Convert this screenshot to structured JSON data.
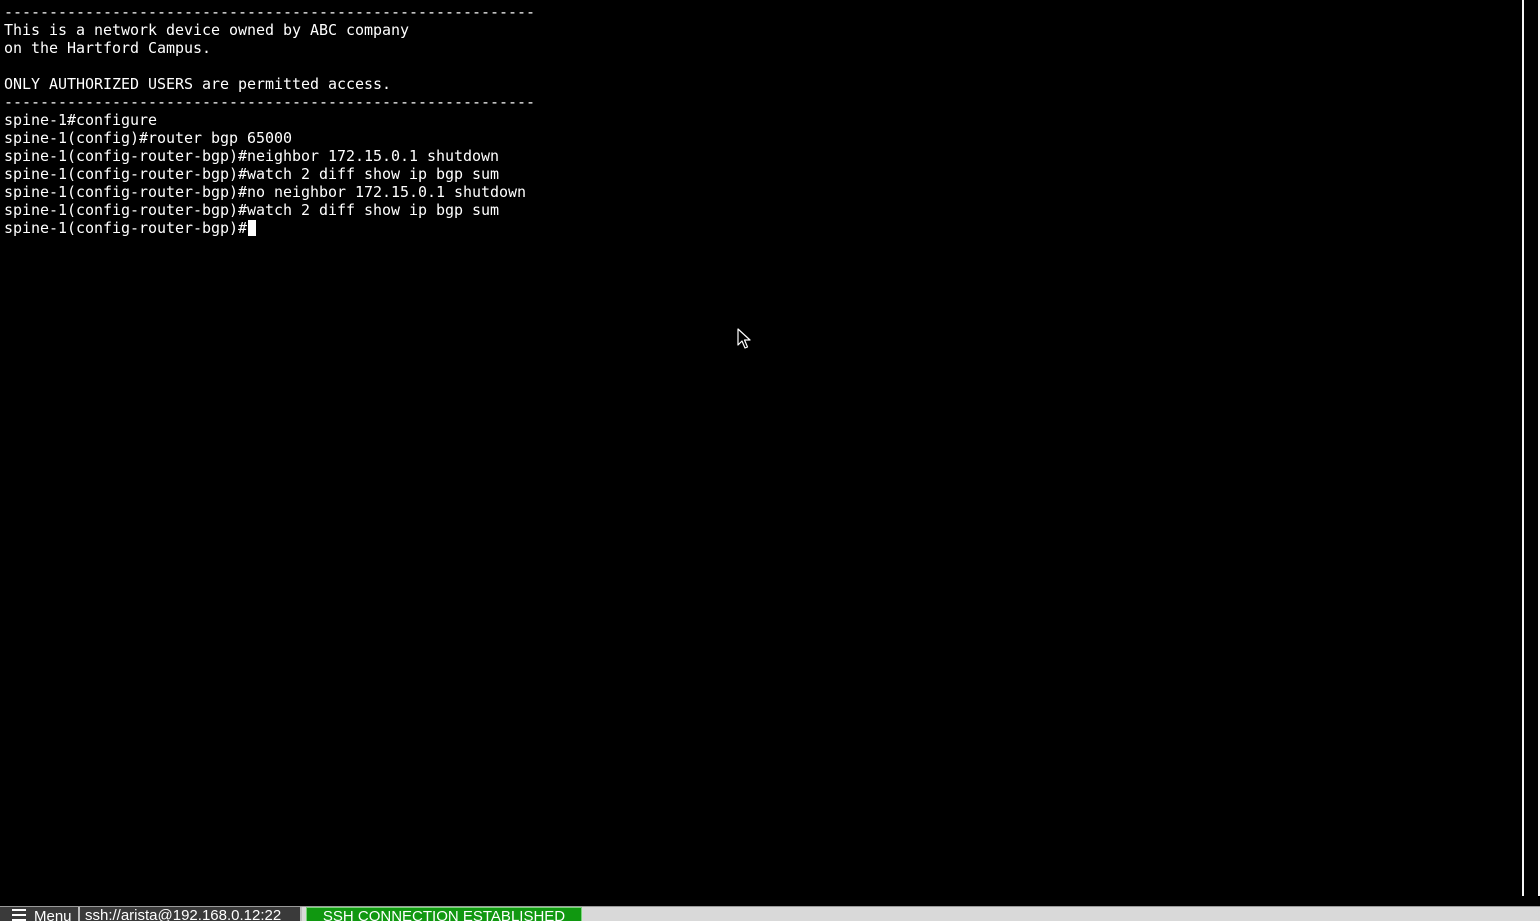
{
  "terminal": {
    "lines": [
      "-----------------------------------------------------------",
      "This is a network device owned by ABC company",
      "on the Hartford Campus.",
      "",
      "ONLY AUTHORIZED USERS are permitted access.",
      "-----------------------------------------------------------",
      "spine-1#configure",
      "spine-1(config)#router bgp 65000",
      "spine-1(config-router-bgp)#neighbor 172.15.0.1 shutdown",
      "spine-1(config-router-bgp)#watch 2 diff show ip bgp sum",
      "spine-1(config-router-bgp)#no neighbor 172.15.0.1 shutdown",
      "spine-1(config-router-bgp)#watch 2 diff show ip bgp sum"
    ],
    "prompt": "spine-1(config-router-bgp)#",
    "background": "#000000",
    "foreground": "#ffffff"
  },
  "statusbar": {
    "menu_icon": "hamburger-menu-icon",
    "menu_label": "Menu",
    "connection_url": "ssh://arista@192.168.0.12:22",
    "connection_status": "SSH CONNECTION ESTABLISHED",
    "status_color": "#109810"
  },
  "cursor": {
    "icon": "mouse-pointer-icon"
  }
}
